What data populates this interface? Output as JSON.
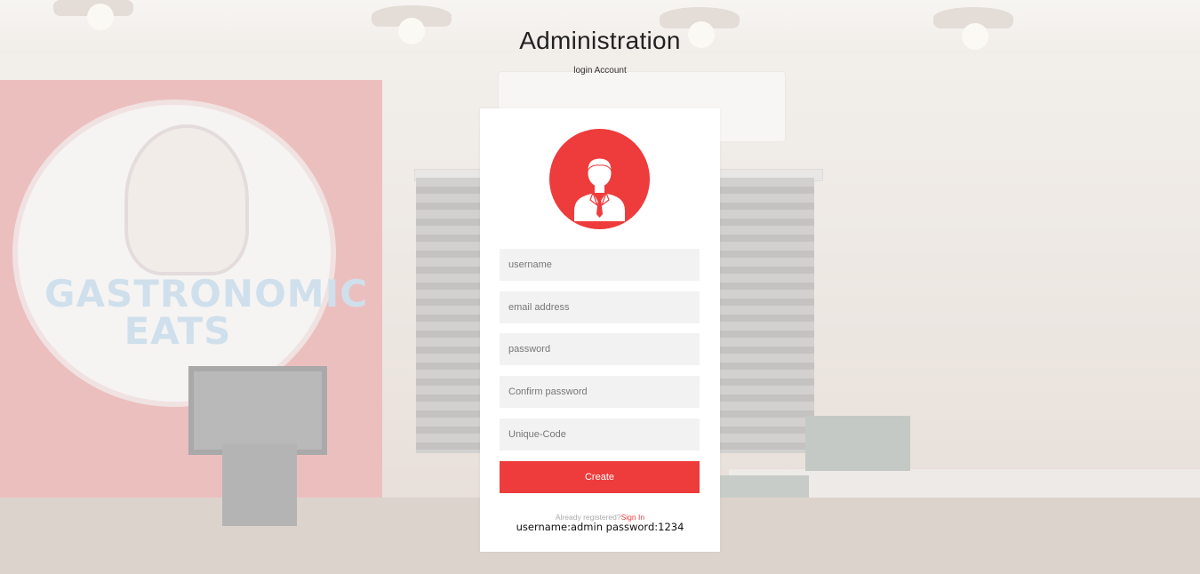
{
  "header": {
    "title": "Administration",
    "subtitle": "login Account"
  },
  "form": {
    "avatar_icon": "user-suit-icon",
    "fields": {
      "username_placeholder": "username",
      "email_placeholder": "email address",
      "password_placeholder": "password",
      "confirm_placeholder": "Confirm password",
      "code_placeholder": "Unique-Code"
    },
    "create_label": "Create",
    "already_text": "Already registered?",
    "signin_label": "Sign In",
    "credentials_note": "username:admin password:1234"
  },
  "background": {
    "sign_text_line1": "GASTRONOMIC",
    "sign_text_line2": "EATS"
  },
  "colors": {
    "accent": "#ee3b3b",
    "card": "#ffffff",
    "field": "#f2f2f2"
  }
}
